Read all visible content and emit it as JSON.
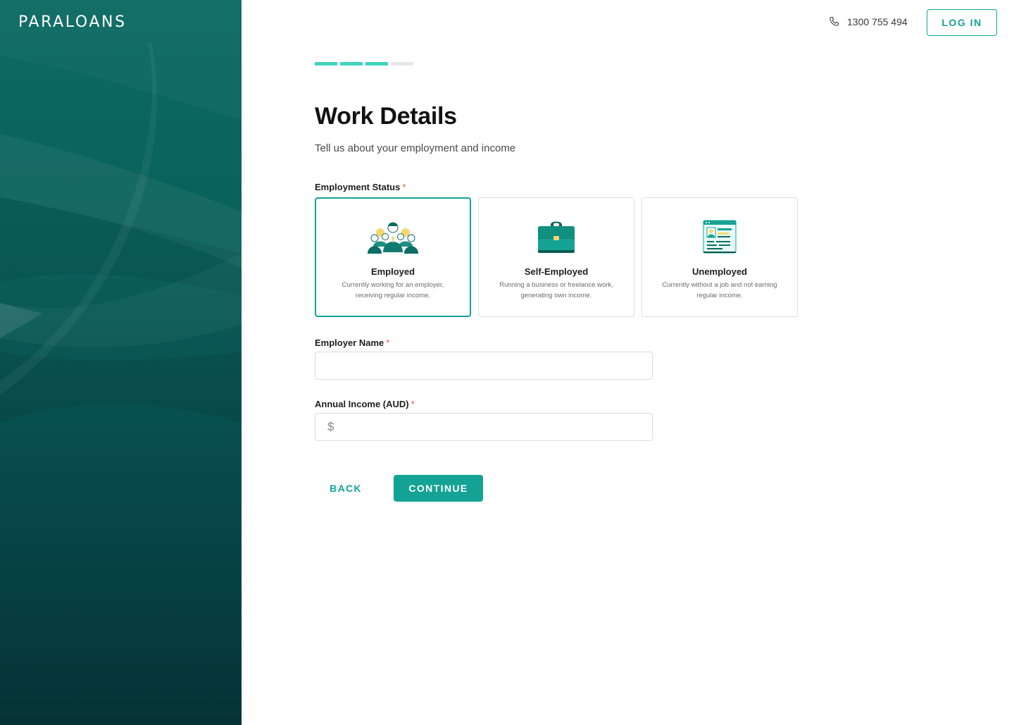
{
  "brand": {
    "logo_text": "PARALOANS",
    "accent": "#14a394",
    "sidebar_color": "#0a5f59"
  },
  "header": {
    "phone_icon": "phone-icon",
    "phone_number": "1300 755 494",
    "login_label": "LOG IN"
  },
  "progress": {
    "total_steps": 4,
    "completed_steps": 3
  },
  "page": {
    "title": "Work Details",
    "subtitle": "Tell us about your employment and income"
  },
  "employment_status": {
    "label": "Employment Status",
    "required_mark": "*",
    "selected": "Employed",
    "options": [
      {
        "title": "Employed",
        "description": "Currently working for an employer, receiving regular income.",
        "icon": "team-people-icon"
      },
      {
        "title": "Self-Employed",
        "description": "Running a business or freelance work, generating own income.",
        "icon": "briefcase-icon"
      },
      {
        "title": "Unemployed",
        "description": "Currently without a job and not earning regular income.",
        "icon": "resume-document-icon"
      }
    ]
  },
  "employer_name": {
    "label": "Employer Name",
    "required_mark": "*",
    "value": "",
    "placeholder": ""
  },
  "annual_income": {
    "label": "Annual Income (AUD)",
    "required_mark": "*",
    "prefix": "$",
    "value": "",
    "placeholder": ""
  },
  "actions": {
    "back_label": "BACK",
    "continue_label": "CONTINUE"
  }
}
